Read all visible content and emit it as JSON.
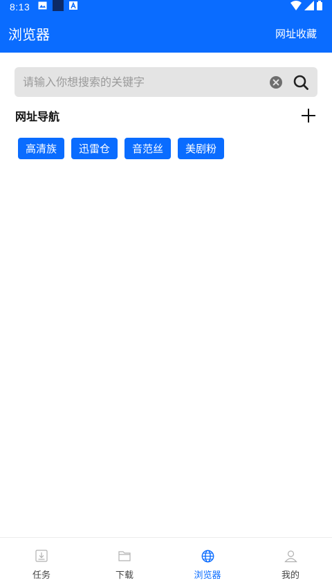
{
  "status_bar": {
    "time": "8:13",
    "icons": [
      "image-icon",
      "square-icon",
      "a-icon",
      "wifi-icon",
      "cell-signal-icon",
      "battery-icon"
    ]
  },
  "app_bar": {
    "title": "浏览器",
    "bookmarks_label": "网址收藏"
  },
  "search": {
    "placeholder": "请输入你想搜索的关键字",
    "value": ""
  },
  "section": {
    "title": "网址导航"
  },
  "chips": [
    {
      "label": "高清族"
    },
    {
      "label": "迅雷仓"
    },
    {
      "label": "音范丝"
    },
    {
      "label": "美剧粉"
    }
  ],
  "bottom_nav": {
    "items": [
      {
        "label": "任务",
        "icon": "download-tray-icon",
        "active": false
      },
      {
        "label": "下载",
        "icon": "folder-icon",
        "active": false
      },
      {
        "label": "浏览器",
        "icon": "globe-icon",
        "active": true
      },
      {
        "label": "我的",
        "icon": "user-icon",
        "active": false
      }
    ]
  },
  "colors": {
    "primary": "#0a6cff",
    "search_bg": "#e4e4e4",
    "inactive_icon": "#b0b0b0",
    "text_dark": "#111111"
  }
}
